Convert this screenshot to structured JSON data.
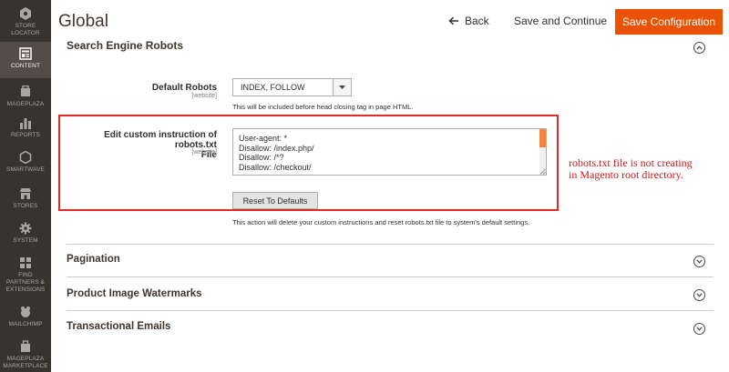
{
  "sidebar": {
    "items": [
      {
        "label_1": "STORE",
        "label_2": "LOCATOR",
        "icon": "store-locator-icon"
      },
      {
        "label_1": "CONTENT",
        "label_2": "",
        "icon": "content-icon",
        "active": true
      },
      {
        "label_1": "MAGEPLAZA",
        "label_2": "",
        "icon": "mageplaza-icon"
      },
      {
        "label_1": "REPORTS",
        "label_2": "",
        "icon": "reports-icon"
      },
      {
        "label_1": "SMARTWAVE",
        "label_2": "",
        "icon": "smartwave-icon"
      },
      {
        "label_1": "STORES",
        "label_2": "",
        "icon": "stores-icon"
      },
      {
        "label_1": "SYSTEM",
        "label_2": "",
        "icon": "system-icon"
      },
      {
        "label_1": "FIND",
        "label_2": "PARTNERS &",
        "label_3": "EXTENSIONS",
        "icon": "partners-icon"
      },
      {
        "label_1": "MAILCHIMP",
        "label_2": "",
        "icon": "mailchimp-icon"
      },
      {
        "label_1": "MAGEPLAZA",
        "label_2": "MARKETPLACE",
        "icon": "marketplace-icon"
      }
    ]
  },
  "header": {
    "title": "Global",
    "back_label": "Back",
    "save_continue_label": "Save and Continue",
    "save_config_label": "Save Configuration"
  },
  "robots_section": {
    "title": "Search Engine Robots",
    "default_robots_label": "Default Robots",
    "default_robots_scope": "[website]",
    "default_robots_value": "INDEX, FOLLOW",
    "default_robots_hint": "This will be included before head closing tag in page HTML.",
    "custom_label_1": "Edit custom instruction of robots.txt",
    "custom_label_2": "File",
    "custom_scope": "[website]",
    "custom_lines": [
      "User-agent: *",
      "Disallow: /index.php/",
      "Disallow: /*?",
      "Disallow: /checkout/"
    ],
    "reset_label": "Reset To Defaults",
    "reset_hint": "This action will delete your custom instructions and reset robots.txt file to system's default settings."
  },
  "annotation": {
    "line_1": "robots.txt file is not creating",
    "line_2": "in Magento root directory."
  },
  "sections": [
    {
      "title": "Pagination"
    },
    {
      "title": "Product Image Watermarks"
    },
    {
      "title": "Transactional Emails"
    }
  ],
  "colors": {
    "sidebar_bg": "#373330",
    "accent": "#eb5202",
    "annotation": "#d01818"
  }
}
